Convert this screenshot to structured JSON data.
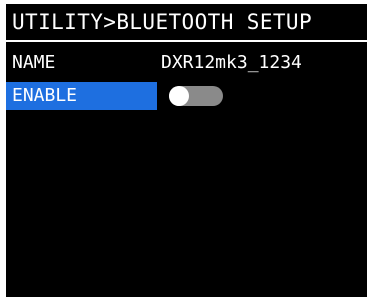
{
  "header": {
    "title": "UTILITY>BLUETOOTH SETUP"
  },
  "settings": {
    "name": {
      "label": "NAME",
      "value": "DXR12mk3_1234"
    },
    "enable": {
      "label": "ENABLE",
      "state": "off",
      "selected": true
    }
  },
  "colors": {
    "background": "#000000",
    "text": "#ffffff",
    "selection": "#1e6fe0",
    "toggle_track_off": "#8a8a8a",
    "toggle_knob": "#ffffff"
  }
}
